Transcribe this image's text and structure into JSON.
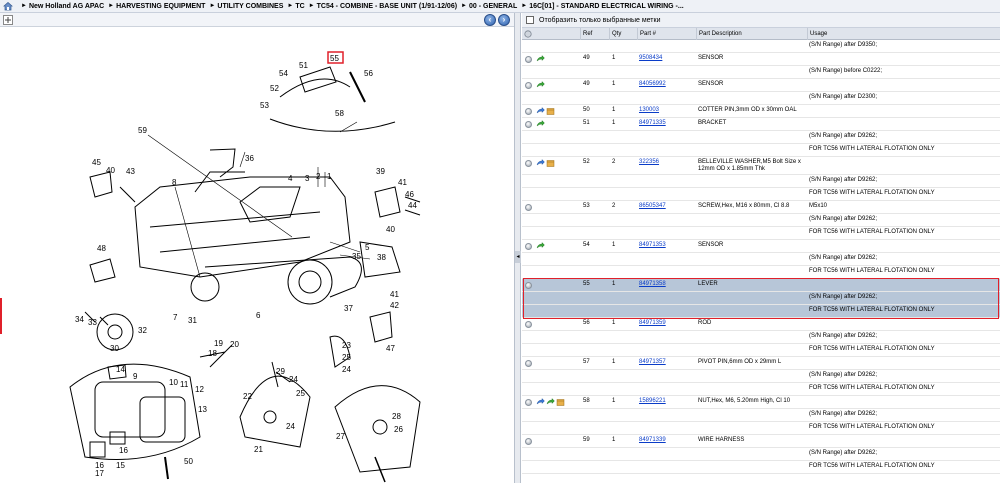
{
  "breadcrumb": {
    "items": [
      "New Holland AG APAC",
      "HARVESTING EQUIPMENT",
      "UTILITY COMBINES",
      "TC",
      "TC54 - COMBINE - BASE UNIT (1/91-12/06)",
      "00 - GENERAL",
      "16C[01] - STANDARD ELECTRICAL WIRING -..."
    ]
  },
  "diagram": {
    "highlighted_callout": "55",
    "callouts": [
      "55",
      "51",
      "54",
      "56",
      "52",
      "53",
      "58",
      "59",
      "36",
      "45",
      "40",
      "43",
      "8",
      "4",
      "3",
      "2",
      "1",
      "39",
      "41",
      "46",
      "44",
      "40",
      "48",
      "5",
      "35",
      "38",
      "41",
      "42",
      "34",
      "33",
      "32",
      "7",
      "31",
      "6",
      "37",
      "30",
      "19",
      "20",
      "18",
      "47",
      "23",
      "25",
      "24",
      "22",
      "29",
      "24",
      "25",
      "14",
      "9",
      "10",
      "11",
      "12",
      "13",
      "50",
      "21",
      "24",
      "28",
      "27",
      "26",
      "16",
      "15",
      "17",
      "16"
    ]
  },
  "filter": {
    "label": "Отобразить только выбранные метки"
  },
  "table": {
    "columns": [
      "",
      "Ref",
      "Qty",
      "Part #",
      "Part Description",
      "Usage"
    ],
    "rows": [
      {
        "ref": "",
        "qty": "",
        "part": "",
        "desc": "",
        "usage": "(S/N Range) after D9350;"
      },
      {
        "ref": "49",
        "qty": "1",
        "part": "9508434",
        "desc": "SENSOR",
        "usage": "",
        "icons": [
          "green"
        ]
      },
      {
        "ref": "",
        "qty": "",
        "part": "",
        "desc": "",
        "usage": "(S/N Range) before C0222;"
      },
      {
        "ref": "49",
        "qty": "1",
        "part": "84056992",
        "desc": "SENSOR",
        "usage": "",
        "icons": [
          "green"
        ]
      },
      {
        "ref": "",
        "qty": "",
        "part": "",
        "desc": "",
        "usage": "(S/N Range) after D2300;"
      },
      {
        "ref": "50",
        "qty": "1",
        "part": "130003",
        "desc": "COTTER PIN,3mm OD x 30mm OAL",
        "usage": "",
        "icons": [
          "blue",
          "box"
        ]
      },
      {
        "ref": "51",
        "qty": "1",
        "part": "84971335",
        "desc": "BRACKET",
        "usage": "",
        "icons": [
          "green"
        ]
      },
      {
        "ref": "",
        "qty": "",
        "part": "",
        "desc": "",
        "usage": "(S/N Range) after D9262;"
      },
      {
        "ref": "",
        "qty": "",
        "part": "",
        "desc": "",
        "usage": "FOR TC56 WITH LATERAL FLOTATION ONLY"
      },
      {
        "ref": "52",
        "qty": "2",
        "part": "322356",
        "desc": "BELLEVILLE WASHER,M5 Bolt Size x 12mm OD x 1.85mm Thk",
        "usage": "",
        "icons": [
          "blue",
          "box"
        ],
        "tall": true
      },
      {
        "ref": "",
        "qty": "",
        "part": "",
        "desc": "",
        "usage": "(S/N Range) after D9262;"
      },
      {
        "ref": "",
        "qty": "",
        "part": "",
        "desc": "",
        "usage": "FOR TC56 WITH LATERAL FLOTATION ONLY"
      },
      {
        "ref": "53",
        "qty": "2",
        "part": "86505347",
        "desc": "SCREW,Hex, M16 x 80mm, Cl 8.8",
        "usage": "M5x10"
      },
      {
        "ref": "",
        "qty": "",
        "part": "",
        "desc": "",
        "usage": "(S/N Range) after D9262;"
      },
      {
        "ref": "",
        "qty": "",
        "part": "",
        "desc": "",
        "usage": "FOR TC56 WITH LATERAL FLOTATION ONLY"
      },
      {
        "ref": "54",
        "qty": "1",
        "part": "84971353",
        "desc": "SENSOR",
        "usage": "",
        "icons": [
          "green"
        ]
      },
      {
        "ref": "",
        "qty": "",
        "part": "",
        "desc": "",
        "usage": "(S/N Range) after D9262;"
      },
      {
        "ref": "",
        "qty": "",
        "part": "",
        "desc": "",
        "usage": "FOR TC56 WITH LATERAL FLOTATION ONLY"
      },
      {
        "ref": "55",
        "qty": "1",
        "part": "84971358",
        "desc": "LEVER",
        "usage": "",
        "selected": true
      },
      {
        "ref": "",
        "qty": "",
        "part": "",
        "desc": "",
        "usage": "(S/N Range) after D9262;",
        "selected": true
      },
      {
        "ref": "",
        "qty": "",
        "part": "",
        "desc": "",
        "usage": "FOR TC56 WITH LATERAL FLOTATION ONLY",
        "selected": true
      },
      {
        "ref": "56",
        "qty": "1",
        "part": "84971359",
        "desc": "ROD",
        "usage": ""
      },
      {
        "ref": "",
        "qty": "",
        "part": "",
        "desc": "",
        "usage": "(S/N Range) after D9262;"
      },
      {
        "ref": "",
        "qty": "",
        "part": "",
        "desc": "",
        "usage": "FOR TC56 WITH LATERAL FLOTATION ONLY"
      },
      {
        "ref": "57",
        "qty": "1",
        "part": "84971357",
        "desc": "PIVOT PIN,6mm OD x 29mm L",
        "usage": ""
      },
      {
        "ref": "",
        "qty": "",
        "part": "",
        "desc": "",
        "usage": "(S/N Range) after D9262;"
      },
      {
        "ref": "",
        "qty": "",
        "part": "",
        "desc": "",
        "usage": "FOR TC56 WITH LATERAL FLOTATION ONLY"
      },
      {
        "ref": "58",
        "qty": "1",
        "part": "15896221",
        "desc": "NUT,Hex, M6, 5.20mm High, Cl 10",
        "usage": "",
        "icons": [
          "blue",
          "green",
          "box"
        ]
      },
      {
        "ref": "",
        "qty": "",
        "part": "",
        "desc": "",
        "usage": "(S/N Range) after D9262;"
      },
      {
        "ref": "",
        "qty": "",
        "part": "",
        "desc": "",
        "usage": "FOR TC56 WITH LATERAL FLOTATION ONLY"
      },
      {
        "ref": "59",
        "qty": "1",
        "part": "84971339",
        "desc": "WIRE HARNESS",
        "usage": ""
      },
      {
        "ref": "",
        "qty": "",
        "part": "",
        "desc": "",
        "usage": "(S/N Range) after D9262;"
      },
      {
        "ref": "",
        "qty": "",
        "part": "",
        "desc": "",
        "usage": "FOR TC56 WITH LATERAL FLOTATION ONLY"
      }
    ]
  },
  "colors": {
    "selection": "#b7c6d8",
    "highlight": "#e0202a",
    "link": "#0a3cc8"
  }
}
